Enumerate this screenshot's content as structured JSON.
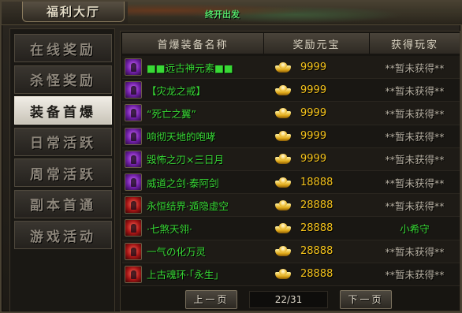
{
  "window": {
    "title": "福利大厅"
  },
  "scene": {
    "label": "终开出发"
  },
  "sidebar": {
    "items": [
      {
        "label": "在线奖励",
        "active": false
      },
      {
        "label": "杀怪奖励",
        "active": false
      },
      {
        "label": "装备首爆",
        "active": true
      },
      {
        "label": "日常活跃",
        "active": false
      },
      {
        "label": "周常活跃",
        "active": false
      },
      {
        "label": "副本首通",
        "active": false
      },
      {
        "label": "游戏活动",
        "active": false
      }
    ]
  },
  "table": {
    "columns": [
      "首爆装备名称",
      "奖励元宝",
      "获得玩家"
    ],
    "rows": [
      {
        "icon": "purple-gem-icon",
        "name": "■■远古神元素■■",
        "reward": "9999",
        "player": "**暂未获得**"
      },
      {
        "icon": "purple-ring-icon",
        "name": "【灾龙之戒】",
        "reward": "9999",
        "player": "**暂未获得**"
      },
      {
        "icon": "purple-charm-icon",
        "name": "“死亡之翼”",
        "reward": "9999",
        "player": "**暂未获得**"
      },
      {
        "icon": "purple-helmet-icon",
        "name": "响彻天地的咆哮",
        "reward": "9999",
        "player": "**暂未获得**"
      },
      {
        "icon": "purple-blade-icon",
        "name": "毁怖之刃×三日月",
        "reward": "9999",
        "player": "**暂未获得**"
      },
      {
        "icon": "purple-sword-icon",
        "name": "威道之剑·泰阿剑",
        "reward": "18888",
        "player": "**暂未获得**"
      },
      {
        "icon": "red-barrier-icon",
        "name": "永恒结界·遁隐虚空",
        "reward": "28888",
        "player": "**暂未获得**"
      },
      {
        "icon": "red-feather-icon",
        "name": "·七煞天翎·",
        "reward": "28888",
        "player": "小希守"
      },
      {
        "icon": "red-flame-icon",
        "name": "一气の化万灵",
        "reward": "28888",
        "player": "**暂未获得**"
      },
      {
        "icon": "red-ring-icon",
        "name": "上古魂环·「永生」",
        "reward": "28888",
        "player": "**暂未获得**"
      }
    ]
  },
  "pager": {
    "prev_label": "上一页",
    "next_label": "下一页",
    "current": "22/31"
  },
  "colors": {
    "item_name": "#38d935",
    "reward": "#f4c21a",
    "unclaimed": "#b8b1a3"
  }
}
